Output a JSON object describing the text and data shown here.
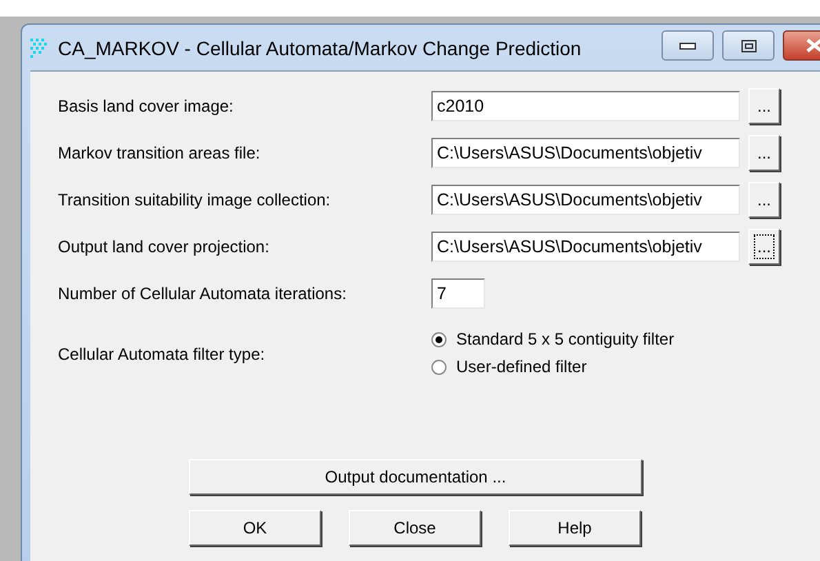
{
  "window": {
    "title": "CA_MARKOV - Cellular Automata/Markov Change Prediction"
  },
  "file_rows": [
    {
      "label": "Basis land cover image:",
      "value": "c2010",
      "browse": "...",
      "focused": false
    },
    {
      "label": "Markov transition areas file:",
      "value": "C:\\Users\\ASUS\\Documents\\objetiv",
      "browse": "...",
      "focused": false
    },
    {
      "label": "Transition suitability image collection:",
      "value": "C:\\Users\\ASUS\\Documents\\objetiv",
      "browse": "...",
      "focused": false
    },
    {
      "label": "Output land cover projection:",
      "value": "C:\\Users\\ASUS\\Documents\\objetiv",
      "browse": "...",
      "focused": true
    }
  ],
  "iterations": {
    "label": "Number of Cellular Automata iterations:",
    "value": "7"
  },
  "filter_type": {
    "label": "Cellular Automata filter type:",
    "options": [
      {
        "label": "Standard 5 x 5 contiguity filter",
        "selected": true
      },
      {
        "label": "User-defined filter",
        "selected": false
      }
    ]
  },
  "documentation_button": "Output documentation ...",
  "buttons": [
    "OK",
    "Close",
    "Help"
  ]
}
